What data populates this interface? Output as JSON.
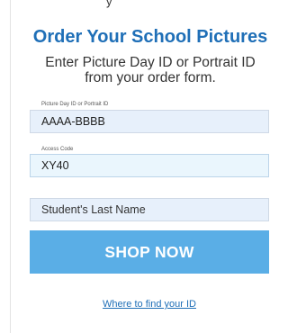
{
  "page": {
    "top_fragment": "y"
  },
  "form": {
    "title": "Order Your School Pictures",
    "subtitle_line1": "Enter Picture Day ID or Portrait ID",
    "subtitle_line2": "from your order form.",
    "picture_id": {
      "label": "Picture Day ID or Portrait ID",
      "value": "AAAA-BBBB"
    },
    "access_code": {
      "label": "Access Code",
      "value": "XY40"
    },
    "last_name": {
      "placeholder": "Student's Last Name",
      "value": ""
    },
    "submit_label": "SHOP NOW",
    "help_link": "Where to find your ID"
  },
  "colors": {
    "title": "#1f6fb7",
    "button": "#5aaee6",
    "field_background": "#e7f0fb",
    "link": "#1f6fb7"
  }
}
